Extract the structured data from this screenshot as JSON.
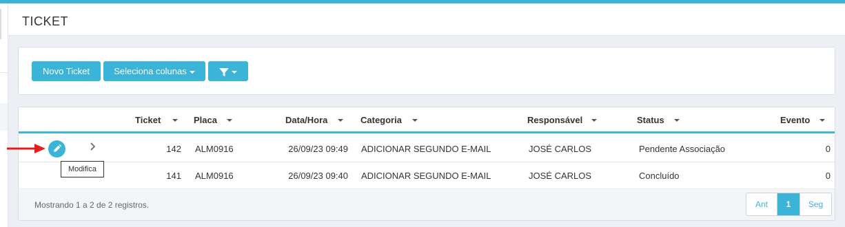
{
  "page": {
    "title": "TICKET"
  },
  "toolbar": {
    "new_ticket_label": "Novo Ticket",
    "select_columns_label": "Seleciona colunas",
    "filter_icon": "filter-icon"
  },
  "table": {
    "columns": [
      "Ticket",
      "Placa",
      "Data/Hora",
      "Categoria",
      "Responsável",
      "Status",
      "Evento"
    ],
    "rows": [
      {
        "ticket": "142",
        "placa": "ALM0916",
        "data_hora": "26/09/23 09:49",
        "categoria": "ADICIONAR SEGUNDO E-MAIL",
        "responsavel": "JOSÉ CARLOS",
        "status": "Pendente Associação",
        "evento": "0"
      },
      {
        "ticket": "141",
        "placa": "ALM0916",
        "data_hora": "26/09/23 09:40",
        "categoria": "ADICIONAR SEGUNDO E-MAIL",
        "responsavel": "JOSÉ CARLOS",
        "status": "Concluído",
        "evento": "0"
      }
    ]
  },
  "tooltip": {
    "text": "Modifica"
  },
  "footer": {
    "info": "Mostrando 1 a 2 de 2 registros.",
    "pagination": {
      "prev": "Ant",
      "current": "1",
      "next": "Seg"
    }
  },
  "colors": {
    "accent": "#3bb4d8",
    "arrow": "#e41e1e"
  }
}
